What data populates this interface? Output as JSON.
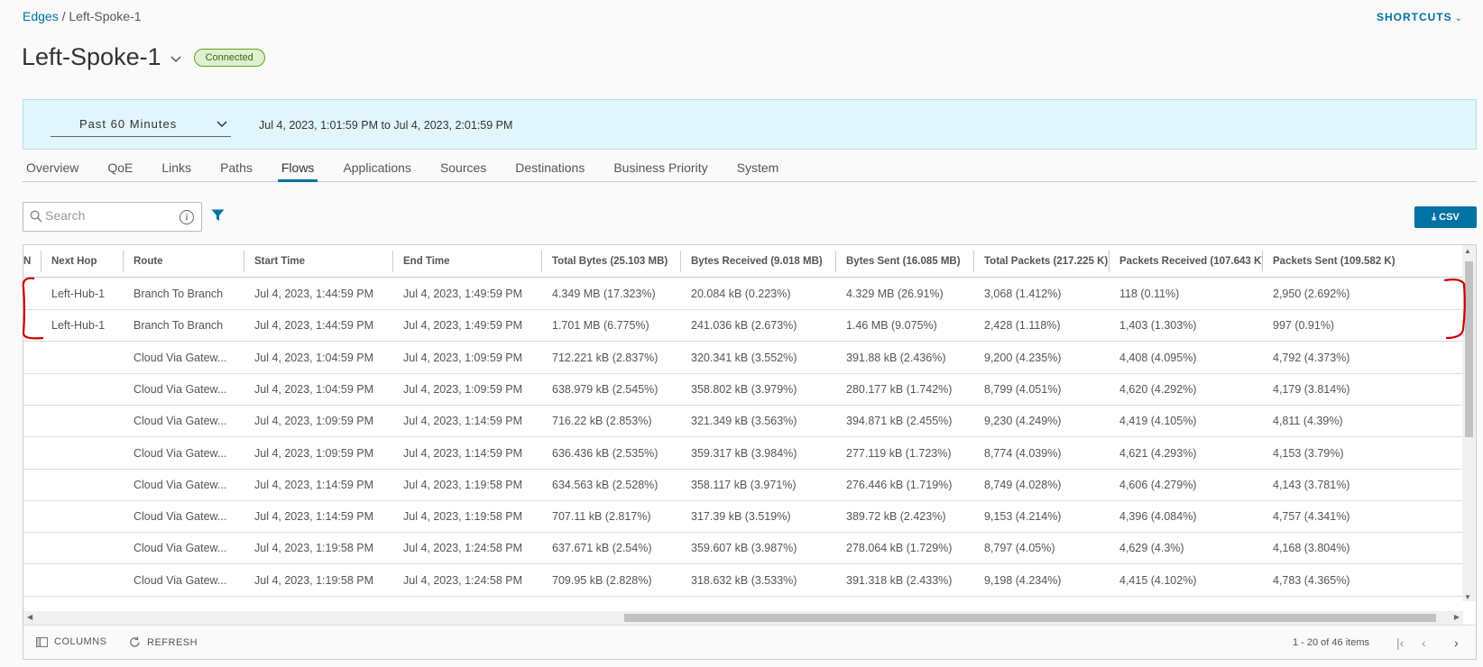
{
  "breadcrumb": {
    "parent": "Edges",
    "sep": " / ",
    "current": "Left-Spoke-1"
  },
  "shortcuts": {
    "label": "SHORTCUTS",
    "caret": "⌄"
  },
  "header": {
    "title": "Left-Spoke-1",
    "status": "Connected"
  },
  "time_filter": {
    "selected": "Past 60 Minutes",
    "range": "Jul 4, 2023, 1:01:59 PM to Jul 4, 2023, 2:01:59 PM"
  },
  "tabs": [
    {
      "label": "Overview"
    },
    {
      "label": "QoE"
    },
    {
      "label": "Links"
    },
    {
      "label": "Paths"
    },
    {
      "label": "Flows"
    },
    {
      "label": "Applications"
    },
    {
      "label": "Sources"
    },
    {
      "label": "Destinations"
    },
    {
      "label": "Business Priority"
    },
    {
      "label": "System"
    }
  ],
  "active_tab": "Flows",
  "search": {
    "placeholder": "Search"
  },
  "csv_button": "CSV",
  "columns": [
    "N",
    "Next Hop",
    "Route",
    "Start Time",
    "End Time",
    "Total Bytes (25.103 MB)",
    "Bytes Received (9.018 MB)",
    "Bytes Sent (16.085 MB)",
    "Total Packets (217.225 K)",
    "Packets Received (107.643 K)",
    "Packets Sent (109.582 K)"
  ],
  "rows": [
    [
      "",
      "Left-Hub-1",
      "Branch To Branch",
      "Jul 4, 2023, 1:44:59 PM",
      "Jul 4, 2023, 1:49:59 PM",
      "4.349 MB (17.323%)",
      "20.084 kB (0.223%)",
      "4.329 MB (26.91%)",
      "3,068 (1.412%)",
      "118 (0.11%)",
      "2,950 (2.692%)"
    ],
    [
      "",
      "Left-Hub-1",
      "Branch To Branch",
      "Jul 4, 2023, 1:44:59 PM",
      "Jul 4, 2023, 1:49:59 PM",
      "1.701 MB (6.775%)",
      "241.036 kB (2.673%)",
      "1.46 MB (9.075%)",
      "2,428 (1.118%)",
      "1,403 (1.303%)",
      "997 (0.91%)"
    ],
    [
      "",
      "",
      "Cloud Via Gatew...",
      "Jul 4, 2023, 1:04:59 PM",
      "Jul 4, 2023, 1:09:59 PM",
      "712.221 kB (2.837%)",
      "320.341 kB (3.552%)",
      "391.88 kB (2.436%)",
      "9,200 (4.235%)",
      "4,408 (4.095%)",
      "4,792 (4.373%)"
    ],
    [
      "",
      "",
      "Cloud Via Gatew...",
      "Jul 4, 2023, 1:04:59 PM",
      "Jul 4, 2023, 1:09:59 PM",
      "638.979 kB (2.545%)",
      "358.802 kB (3.979%)",
      "280.177 kB (1.742%)",
      "8,799 (4.051%)",
      "4,620 (4.292%)",
      "4,179 (3.814%)"
    ],
    [
      "",
      "",
      "Cloud Via Gatew...",
      "Jul 4, 2023, 1:09:59 PM",
      "Jul 4, 2023, 1:14:59 PM",
      "716.22 kB (2.853%)",
      "321.349 kB (3.563%)",
      "394.871 kB (2.455%)",
      "9,230 (4.249%)",
      "4,419 (4.105%)",
      "4,811 (4.39%)"
    ],
    [
      "",
      "",
      "Cloud Via Gatew...",
      "Jul 4, 2023, 1:09:59 PM",
      "Jul 4, 2023, 1:14:59 PM",
      "636.436 kB (2.535%)",
      "359.317 kB (3.984%)",
      "277.119 kB (1.723%)",
      "8,774 (4.039%)",
      "4,621 (4.293%)",
      "4,153 (3.79%)"
    ],
    [
      "",
      "",
      "Cloud Via Gatew...",
      "Jul 4, 2023, 1:14:59 PM",
      "Jul 4, 2023, 1:19:58 PM",
      "634.563 kB (2.528%)",
      "358.117 kB (3.971%)",
      "276.446 kB (1.719%)",
      "8,749 (4.028%)",
      "4,606 (4.279%)",
      "4,143 (3.781%)"
    ],
    [
      "",
      "",
      "Cloud Via Gatew...",
      "Jul 4, 2023, 1:14:59 PM",
      "Jul 4, 2023, 1:19:58 PM",
      "707.11 kB (2.817%)",
      "317.39 kB (3.519%)",
      "389.72 kB (2.423%)",
      "9,153 (4.214%)",
      "4,396 (4.084%)",
      "4,757 (4.341%)"
    ],
    [
      "",
      "",
      "Cloud Via Gatew...",
      "Jul 4, 2023, 1:19:58 PM",
      "Jul 4, 2023, 1:24:58 PM",
      "637.671 kB (2.54%)",
      "359.607 kB (3.987%)",
      "278.064 kB (1.729%)",
      "8,797 (4.05%)",
      "4,629 (4.3%)",
      "4,168 (3.804%)"
    ],
    [
      "",
      "",
      "Cloud Via Gatew...",
      "Jul 4, 2023, 1:19:58 PM",
      "Jul 4, 2023, 1:24:58 PM",
      "709.95 kB (2.828%)",
      "318.632 kB (3.533%)",
      "391.318 kB (2.433%)",
      "9,198 (4.234%)",
      "4,415 (4.102%)",
      "4,783 (4.365%)"
    ]
  ],
  "footer": {
    "columns_label": "COLUMNS",
    "refresh_label": "REFRESH",
    "pagination": "1 - 20 of 46 items"
  },
  "colors": {
    "accent": "#0072a3",
    "status_bg": "#dff0d0",
    "annotation": "#cc0000"
  }
}
